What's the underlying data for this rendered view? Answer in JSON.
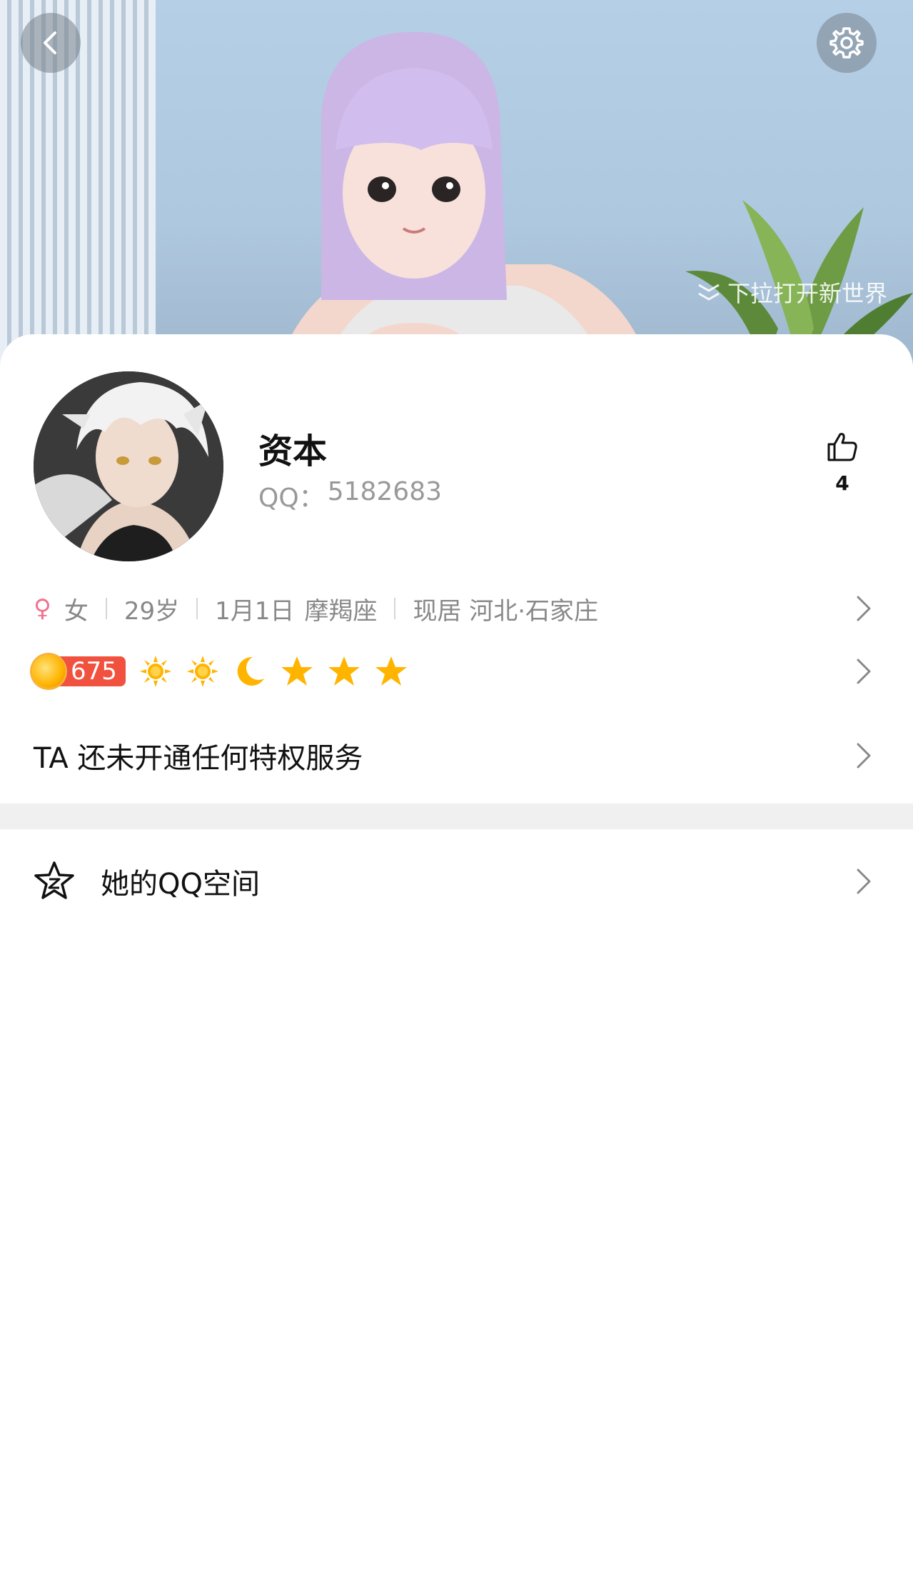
{
  "header": {
    "pull_hint": "下拉打开新世界"
  },
  "profile": {
    "name": "资本",
    "qq_label": "QQ：",
    "qq_number": "5182683",
    "likes": "4",
    "gender_symbol": "♀",
    "gender": "女",
    "age": "29岁",
    "birthday": "1月1日",
    "zodiac": "摩羯座",
    "location": "现居 河北·石家庄"
  },
  "level": {
    "badge_value": "675",
    "icons": [
      "sun-icon",
      "sun-icon",
      "moon-icon",
      "star-icon",
      "star-icon",
      "star-icon"
    ]
  },
  "privilege": {
    "text": "TA 还未开通任何特权服务"
  },
  "zone": {
    "text": "她的QQ空间"
  },
  "colors": {
    "accent_red": "#f0523f",
    "gender_pink": "#f2728f",
    "level_gold": "#ffb400"
  }
}
